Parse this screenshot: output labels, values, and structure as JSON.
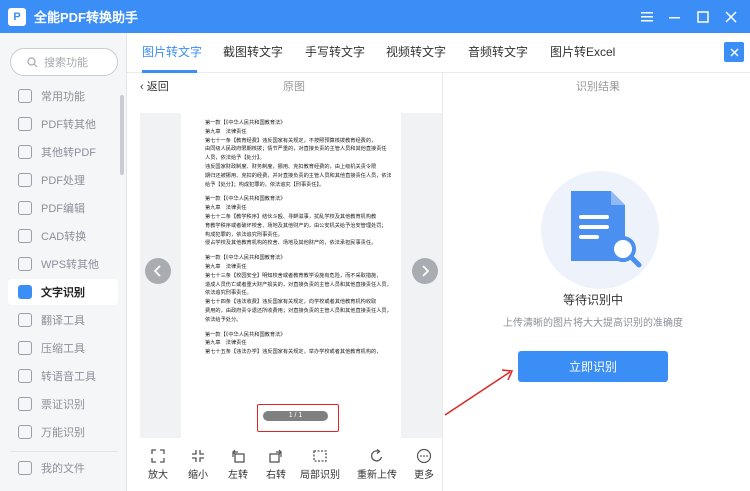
{
  "app": {
    "title": "全能PDF转换助手",
    "logo_text": "P"
  },
  "window": {
    "menu_icon": "menu-icon",
    "minimize_icon": "minimize-icon",
    "maximize_icon": "maximize-icon",
    "close_icon": "close-icon"
  },
  "sidebar": {
    "search_placeholder": "搜索功能",
    "items": [
      {
        "label": "常用功能",
        "icon": "star-icon"
      },
      {
        "label": "PDF转其他",
        "icon": "pdf-convert-icon"
      },
      {
        "label": "其他转PDF",
        "icon": "to-pdf-icon"
      },
      {
        "label": "PDF处理",
        "icon": "pdf-process-icon"
      },
      {
        "label": "PDF编辑",
        "icon": "pdf-edit-icon"
      },
      {
        "label": "CAD转换",
        "icon": "cad-icon"
      },
      {
        "label": "WPS转其他",
        "icon": "wps-icon"
      },
      {
        "label": "文字识别",
        "icon": "ocr-icon"
      },
      {
        "label": "翻译工具",
        "icon": "translate-icon"
      },
      {
        "label": "压缩工具",
        "icon": "compress-icon"
      },
      {
        "label": "转语音工具",
        "icon": "speech-icon"
      },
      {
        "label": "票证识别",
        "icon": "ticket-icon"
      },
      {
        "label": "万能识别",
        "icon": "universal-icon"
      }
    ],
    "active_item": "文字识别",
    "my_files": "我的文件"
  },
  "tabs": [
    "图片转文字",
    "截图转文字",
    "手写转文字",
    "视频转文字",
    "音频转文字",
    "图片转Excel"
  ],
  "active_tab": "图片转文字",
  "subheader": {
    "back": "返回",
    "original": "原图",
    "result": "识别结果"
  },
  "document": {
    "lines": [
      "第一款【《中华人民共和国教育法》",
      "第九章　法律责任",
      "第七十一条【教育经费】违反国家有关规定，不按照预算核拨教育经费的，",
      "由同级人民政府限期核拨；情节严重的，对直接负责的主管人员和其他直接责任",
      "人员，依法给予【处分】。",
      "违反国家财政制度、财务制度，挪用、克扣教育经费的，由上级机关责令限",
      "期归还被挪用、克扣的经费，并对直接负责的主管人员和其他直接责任人员，依法",
      "给予【处分】；构成犯罪的，依法追究【刑事责任】。",
      "",
      "第一款【《中华人民共和国教育法》",
      "第九章　法律责任",
      "第七十二条【教学秩序】结伙斗殴、寻衅滋事，扰乱学校及其他教育机构教",
      "育教学秩序或者破坏校舍、场地及其他财产的，由公安机关给予治安管理处罚；",
      "构成犯罪的，依法追究刑事责任。",
      "侵占学校及其他教育机构的校舍、场地及其他财产的，依法承担民事责任。",
      "",
      "第一款【《中华人民共和国教育法》",
      "第九章　法律责任",
      "第七十三条【校园安全】明知校舍或者教育教学设施有危险，而不采取措施，",
      "造成人员伤亡或者重大财产损失的，对直接负责的主管人员和其他直接责任人员，",
      "依法追究刑事责任。",
      "第七十四条【违法收费】违反国家有关规定，向学校或者其他教育机构收取",
      "费用的，由政府责令退还所收费用；对直接负责的主管人员和其他直接责任人员，",
      "依法给予处分。",
      "",
      "第一款【《中华人民共和国教育法》",
      "第九章　法律责任",
      "第七十五条【违法办学】违反国家有关规定，举办学校或者其他教育机构的，"
    ],
    "page_indicator": "1 / 1"
  },
  "toolbar": [
    {
      "label": "放大",
      "icon": "zoom-in-icon"
    },
    {
      "label": "缩小",
      "icon": "zoom-out-icon"
    },
    {
      "label": "左转",
      "icon": "rotate-left-icon"
    },
    {
      "label": "右转",
      "icon": "rotate-right-icon"
    },
    {
      "label": "局部识别",
      "icon": "crop-icon"
    },
    {
      "label": "重新上传",
      "icon": "reupload-icon"
    },
    {
      "label": "更多",
      "icon": "more-icon"
    }
  ],
  "result": {
    "status_title": "等待识别中",
    "tip": "上传清晰的图片将大大提高识别的准确度",
    "start_button": "立即识别"
  },
  "colors": {
    "accent": "#3a8ef6",
    "annotation": "#e02424"
  }
}
